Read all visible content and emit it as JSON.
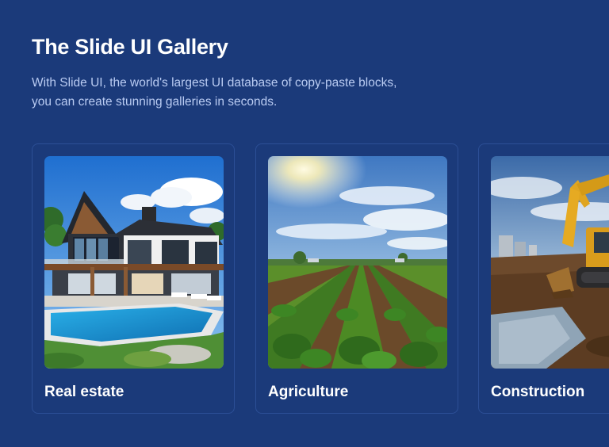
{
  "header": {
    "title": "The Slide UI Gallery",
    "description_line1": "With Slide UI, the world's largest UI database of copy-paste blocks,",
    "description_line2": "you can create stunning galleries in seconds."
  },
  "cards": [
    {
      "label": "Real estate",
      "image": "modern-house-with-pool-photo"
    },
    {
      "label": "Agriculture",
      "image": "crop-field-rows-photo"
    },
    {
      "label": "Construction",
      "image": "excavator-construction-site-photo"
    }
  ],
  "colors": {
    "background": "#1b3a7a",
    "card_border": "#2c4f96",
    "title_text": "#ffffff",
    "description_text": "#b9cbf2"
  }
}
